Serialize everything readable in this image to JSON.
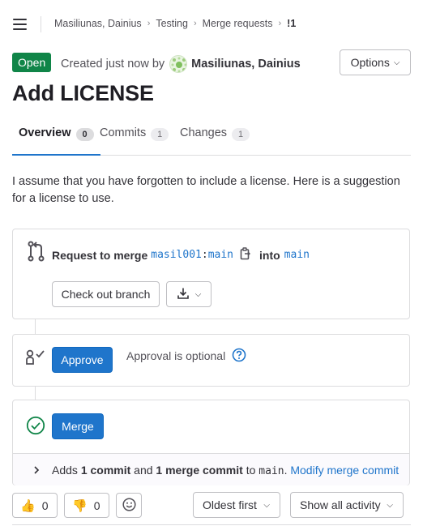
{
  "breadcrumb": {
    "items": [
      "Masiliunas, Dainius",
      "Testing",
      "Merge requests",
      "!1"
    ]
  },
  "header": {
    "status": "Open",
    "created_text": "Created just now by",
    "author": "Masiliunas, Dainius",
    "options_label": "Options"
  },
  "title": "Add LICENSE",
  "tabs": [
    {
      "label": "Overview",
      "count": "0",
      "active": true
    },
    {
      "label": "Commits",
      "count": "1",
      "active": false
    },
    {
      "label": "Changes",
      "count": "1",
      "active": false
    }
  ],
  "description": "I assume that you have forgotten to include a license. Here is a suggestion for a license to use.",
  "merge_request_widget": {
    "request_prefix": "Request to merge",
    "source_namespace": "masil001",
    "separator": ":",
    "source_branch": "main",
    "into_text": "into",
    "target_branch": "main",
    "checkout_label": "Check out branch"
  },
  "approval": {
    "button_label": "Approve",
    "optional_text": "Approval is optional"
  },
  "merge": {
    "button_label": "Merge",
    "adds_text": "Adds",
    "commit_count_text": "1 commit",
    "and_text": "and",
    "merge_commit_text": "1 merge commit",
    "to_text": "to",
    "target_branch": "main",
    "period": ".",
    "modify_link": "Modify merge commit"
  },
  "reactions": {
    "thumbs_up_count": "0",
    "thumbs_down_count": "0"
  },
  "sort": {
    "order_label": "Oldest first",
    "filter_label": "Show all activity"
  },
  "colors": {
    "accent": "#1f75cb",
    "status_open": "#108548",
    "success": "#108548"
  },
  "icons": [
    "hamburger-icon",
    "chevron-right-icon",
    "merge-request-icon",
    "copy-icon",
    "download-icon",
    "approval-icon",
    "help-icon",
    "check-circle-icon",
    "thumbs-up-icon",
    "thumbs-down-icon",
    "smiley-icon",
    "chevron-down-icon"
  ]
}
